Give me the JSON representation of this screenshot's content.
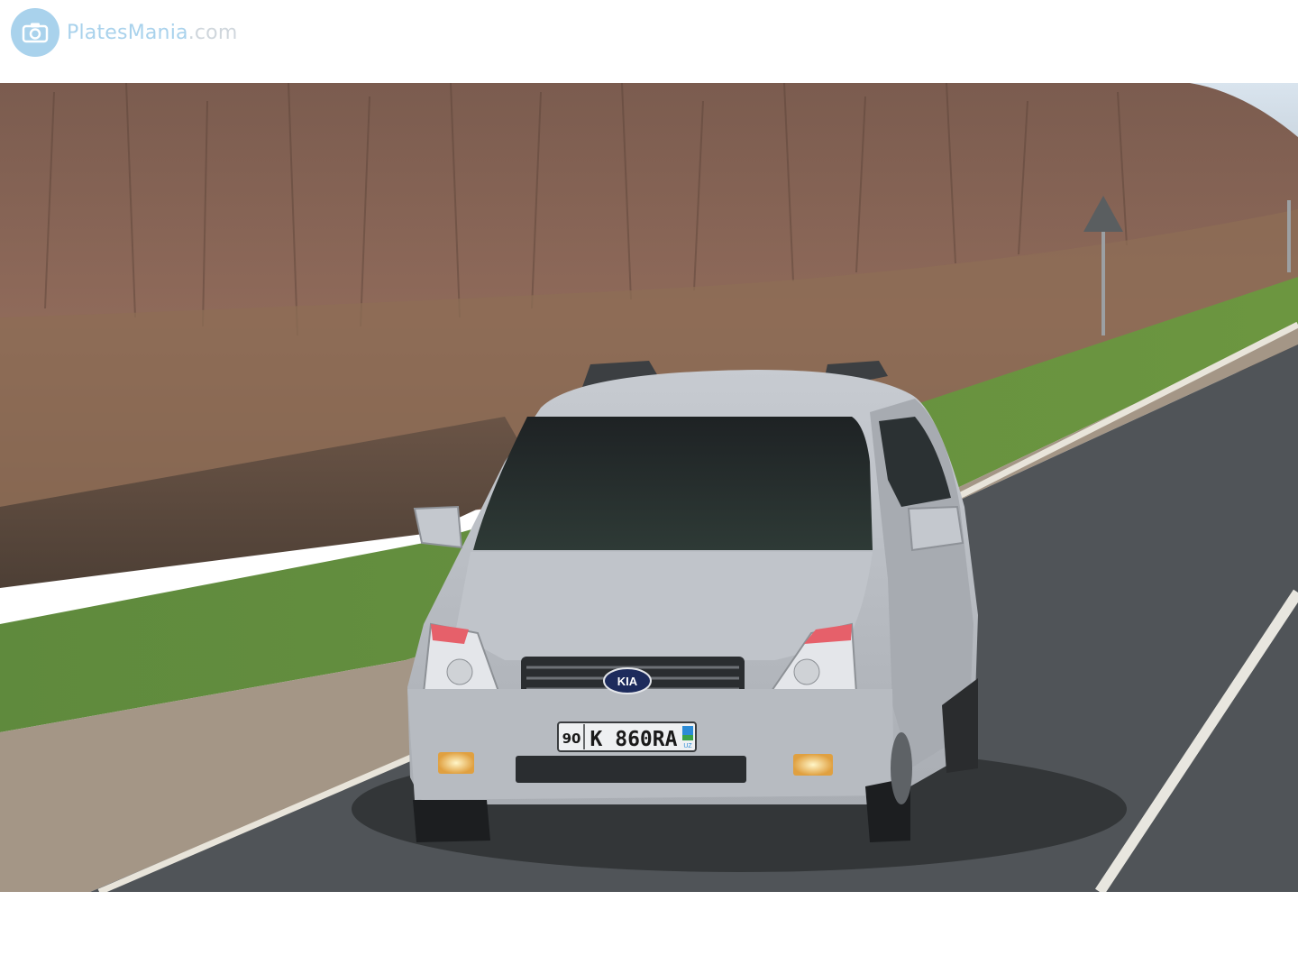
{
  "header": {
    "logo_text_plates": "Plates",
    "logo_text_mania": "Mania",
    "logo_text_domain": ".com",
    "logo_icon": "camera-icon"
  },
  "photo": {
    "car_badge": "KIA",
    "plate": {
      "region": "90",
      "number": "K 860RA",
      "country": "UZ"
    }
  },
  "colors": {
    "brand": "#a9d2ec",
    "car_body": "#b9bdc3",
    "road": "#505458"
  }
}
